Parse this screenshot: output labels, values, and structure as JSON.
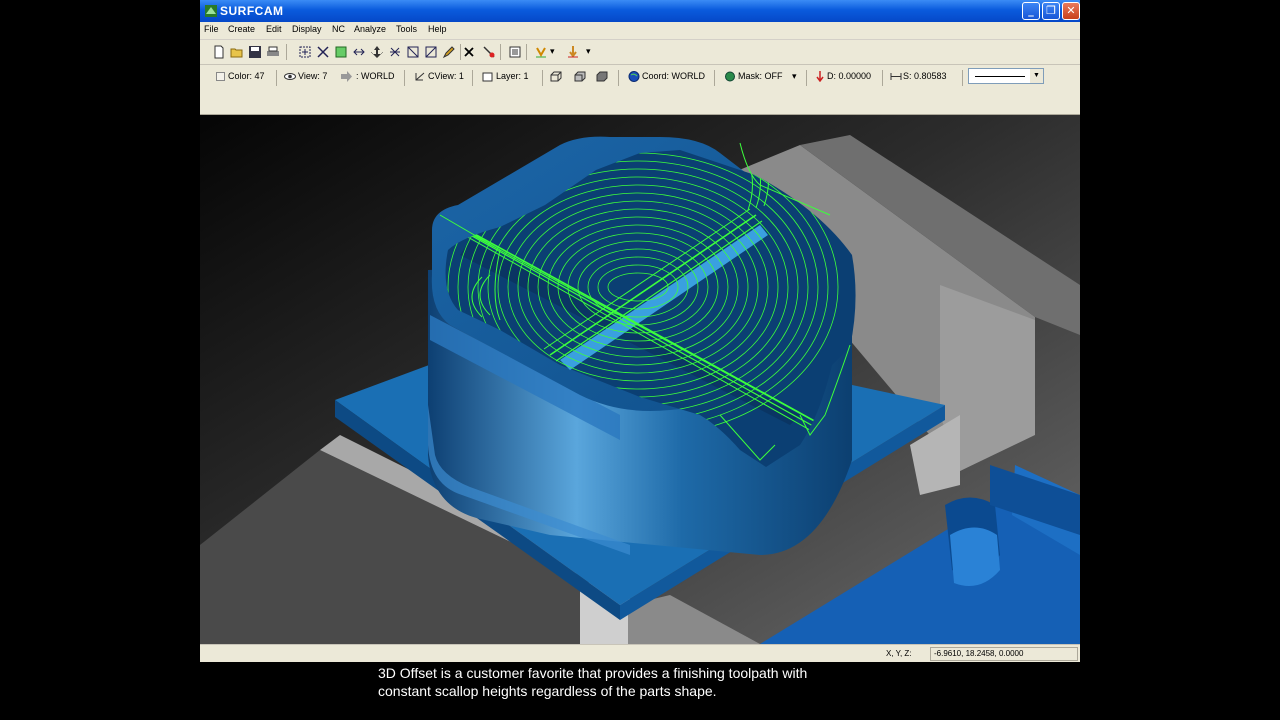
{
  "window": {
    "title": "SURFCAM",
    "buttons": {
      "minimize": "_",
      "maximize": "❐",
      "close": "✕"
    }
  },
  "menu": [
    "File",
    "Create",
    "Edit",
    "Display",
    "NC",
    "Analyze",
    "Tools",
    "Help"
  ],
  "toolbar1": {
    "icons": [
      "new-file-icon",
      "open-folder-icon",
      "save-icon",
      "print-icon",
      "zoom-window-icon",
      "zoom-all-icon",
      "dynamic-rotate-icon",
      "redraw-icon",
      "pan-icon",
      "rotate-icon",
      "zoom-icon",
      "zoom-extents-icon",
      "edit-pencil-icon",
      "delete-icon",
      "trim-icon",
      "list-icon",
      "snap-icon",
      "point-arrow-icon"
    ]
  },
  "toolbar2": {
    "color_label": "Color: 47",
    "view_label": "View: 7",
    "world_label": ": WORLD",
    "cview_label": "CView: 1",
    "layer_label": "Layer: 1",
    "coord_label": "Coord: WORLD",
    "mask_label": "Mask: OFF",
    "depth_label": "D: 0.00000",
    "step_label": "S: 0.80583"
  },
  "colors": {
    "part_blue": "#1f6fb0",
    "toolpath_green": "#3cff3c",
    "vise_gray": "#8a8a8a",
    "titlebar_blue": "#0a5bdd"
  },
  "status": {
    "coord_label": "X, Y, Z:",
    "coord_value": "-6.9610, 18.2458, 0.0000"
  },
  "caption": {
    "line1": "3D Offset is a customer favorite that provides a finishing toolpath with",
    "line2": "constant scallop heights regardless of the parts shape."
  }
}
